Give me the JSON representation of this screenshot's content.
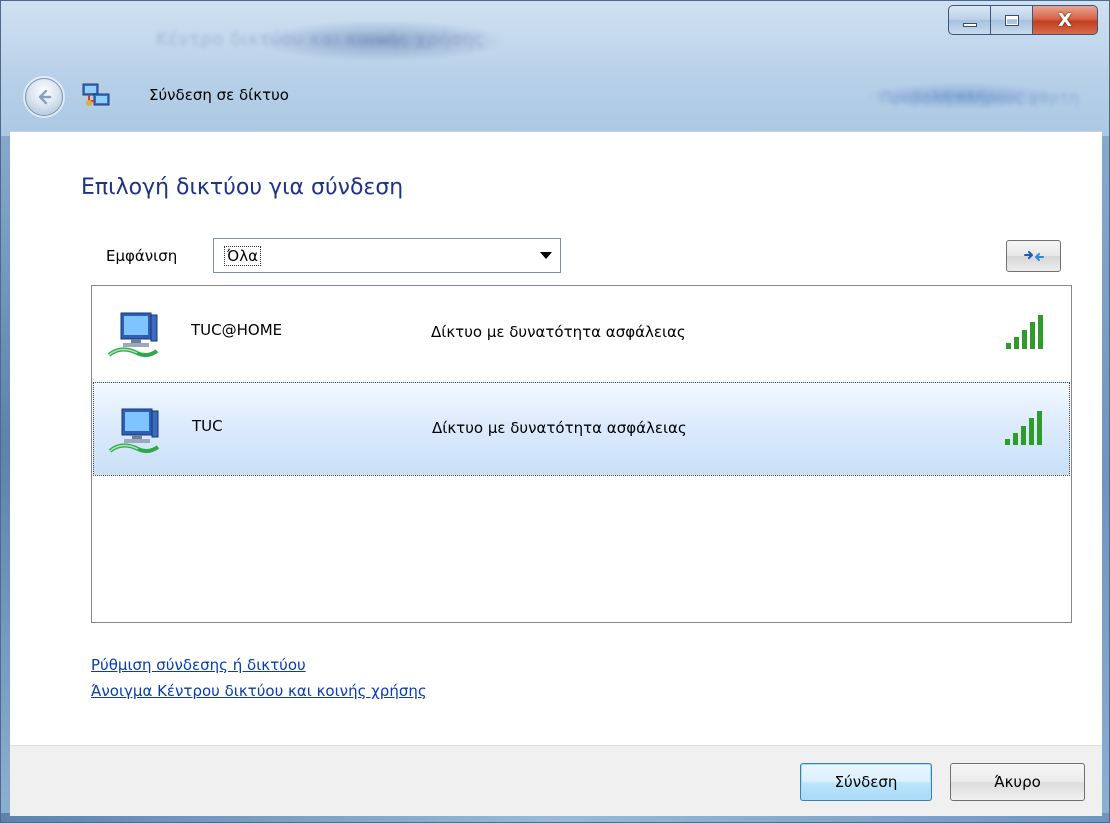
{
  "window": {
    "title": "Κέντρο δικτύου και κοινής χρήσης",
    "close_label": "X",
    "header_right_text": "Προβολή πλήρους χάρτη"
  },
  "nav": {
    "title": "Σύνδεση σε δίκτυο"
  },
  "main": {
    "heading": "Επιλογή δικτύου για σύνδεση",
    "show_label": "Εμφάνιση",
    "show_value": "Όλα"
  },
  "networks": [
    {
      "name": "TUC@HOME",
      "security": "Δίκτυο με δυνατότητα ασφάλειας",
      "signal_bars": 5,
      "selected": false
    },
    {
      "name": "TUC",
      "security": "Δίκτυο με δυνατότητα ασφάλειας",
      "signal_bars": 5,
      "selected": true
    }
  ],
  "links": {
    "setup": "Ρύθμιση σύνδεσης ή δικτύου",
    "open_center": "Άνοιγμα Κέντρου δικτύου και κοινής χρήσης"
  },
  "footer": {
    "connect_label": "Σύνδεση",
    "cancel_label": "Άκυρο"
  },
  "colors": {
    "heading": "#1e3287",
    "link": "#0a3cb0",
    "signal": "#2e9b2a",
    "selection": "#c9e0f7"
  },
  "icons": {
    "back": "back-arrow-icon",
    "network_center": "network-center-icon",
    "refresh": "refresh-icon",
    "computer": "network-computer-icon",
    "signal": "signal-strength-icon"
  }
}
